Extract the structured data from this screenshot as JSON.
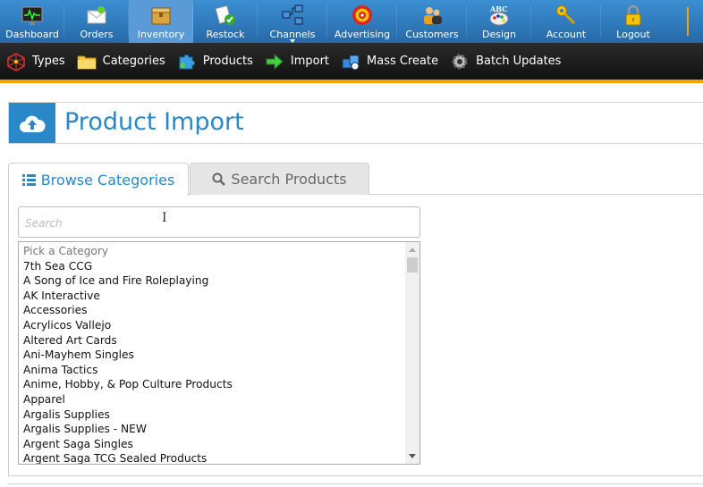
{
  "topnav": {
    "items": [
      {
        "label": "Dashboard",
        "icon": "dashboard-icon"
      },
      {
        "label": "Orders",
        "icon": "orders-icon"
      },
      {
        "label": "Inventory",
        "icon": "inventory-icon",
        "active": true
      },
      {
        "label": "Restock",
        "icon": "restock-icon"
      },
      {
        "label": "Channels",
        "icon": "channels-icon"
      },
      {
        "label": "Advertising",
        "icon": "advertising-icon"
      },
      {
        "label": "Customers",
        "icon": "customers-icon"
      },
      {
        "label": "Design",
        "icon": "design-icon"
      },
      {
        "label": "Account",
        "icon": "account-key-icon"
      },
      {
        "label": "Logout",
        "icon": "lock-icon"
      }
    ]
  },
  "subnav": {
    "items": [
      {
        "label": "Types",
        "icon": "types-icon"
      },
      {
        "label": "Categories",
        "icon": "folder-icon"
      },
      {
        "label": "Products",
        "icon": "puzzle-icon"
      },
      {
        "label": "Import",
        "icon": "arrow-right-icon"
      },
      {
        "label": "Mass Create",
        "icon": "boxes-icon"
      },
      {
        "label": "Batch Updates",
        "icon": "gear-icon"
      }
    ]
  },
  "page": {
    "title": "Product Import"
  },
  "tabs": {
    "browse": "Browse Categories",
    "search": "Search Products"
  },
  "search": {
    "placeholder": "Search"
  },
  "categories": {
    "placeholder": "Pick a Category",
    "items": [
      "7th Sea CCG",
      "A Song of Ice and Fire Roleplaying",
      "AK Interactive",
      "Accessories",
      "Acrylicos Vallejo",
      "Altered Art Cards",
      "Ani-Mayhem Singles",
      "Anima Tactics",
      "Anime, Hobby, & Pop Culture Products",
      "Apparel",
      "Argalis Supplies",
      "Argalis Supplies - NEW",
      "Argent Saga Singles",
      "Argent Saga TCG Sealed Products"
    ]
  },
  "colors": {
    "accent": "#2a87c8",
    "orange": "#f2a400",
    "navbar": "#2f7fc1"
  }
}
